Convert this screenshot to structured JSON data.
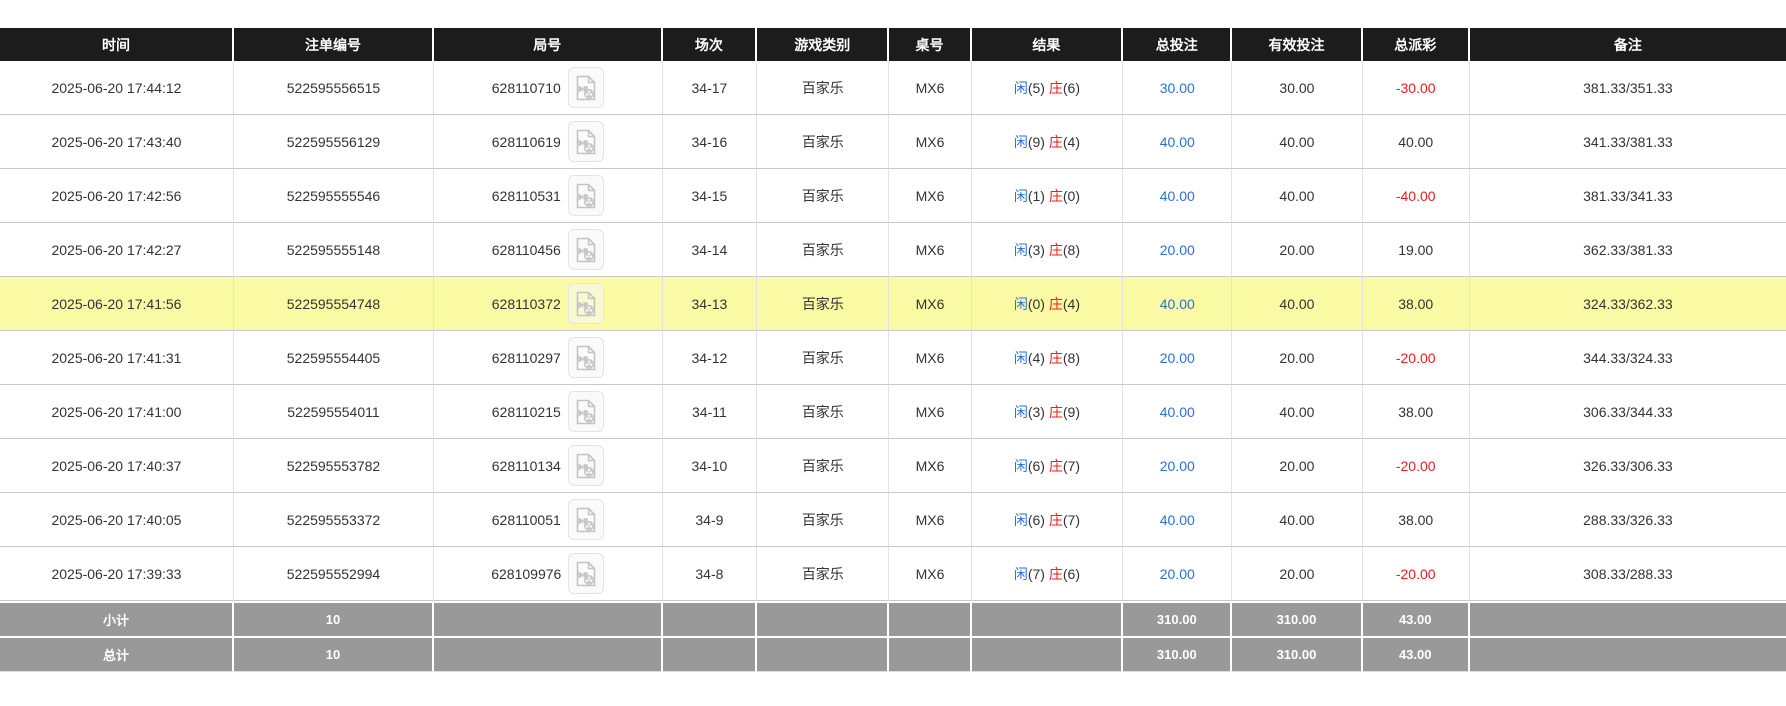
{
  "table": {
    "columns": [
      {
        "key": "time",
        "label": "时间"
      },
      {
        "key": "bet_id",
        "label": "注单编号"
      },
      {
        "key": "round",
        "label": "局号"
      },
      {
        "key": "session",
        "label": "场次"
      },
      {
        "key": "game",
        "label": "游戏类别"
      },
      {
        "key": "table_no",
        "label": "桌号"
      },
      {
        "key": "result",
        "label": "结果"
      },
      {
        "key": "total_bet",
        "label": "总投注"
      },
      {
        "key": "valid_bet",
        "label": "有效投注"
      },
      {
        "key": "payout",
        "label": "总派彩"
      },
      {
        "key": "remark",
        "label": "备注"
      }
    ],
    "result_labels": {
      "player": "闲",
      "banker": "庄"
    },
    "rows": [
      {
        "time": "2025-06-20 17:44:12",
        "bet_id": "522595556515",
        "round": "628110710",
        "session": "34-17",
        "game": "百家乐",
        "table_no": "MX6",
        "player": "5",
        "banker": "6",
        "total_bet": "30.00",
        "valid_bet": "30.00",
        "payout": "-30.00",
        "remark": "381.33/351.33",
        "highlighted": false
      },
      {
        "time": "2025-06-20 17:43:40",
        "bet_id": "522595556129",
        "round": "628110619",
        "session": "34-16",
        "game": "百家乐",
        "table_no": "MX6",
        "player": "9",
        "banker": "4",
        "total_bet": "40.00",
        "valid_bet": "40.00",
        "payout": "40.00",
        "remark": "341.33/381.33",
        "highlighted": false
      },
      {
        "time": "2025-06-20 17:42:56",
        "bet_id": "522595555546",
        "round": "628110531",
        "session": "34-15",
        "game": "百家乐",
        "table_no": "MX6",
        "player": "1",
        "banker": "0",
        "total_bet": "40.00",
        "valid_bet": "40.00",
        "payout": "-40.00",
        "remark": "381.33/341.33",
        "highlighted": false
      },
      {
        "time": "2025-06-20 17:42:27",
        "bet_id": "522595555148",
        "round": "628110456",
        "session": "34-14",
        "game": "百家乐",
        "table_no": "MX6",
        "player": "3",
        "banker": "8",
        "total_bet": "20.00",
        "valid_bet": "20.00",
        "payout": "19.00",
        "remark": "362.33/381.33",
        "highlighted": false
      },
      {
        "time": "2025-06-20 17:41:56",
        "bet_id": "522595554748",
        "round": "628110372",
        "session": "34-13",
        "game": "百家乐",
        "table_no": "MX6",
        "player": "0",
        "banker": "4",
        "total_bet": "40.00",
        "valid_bet": "40.00",
        "payout": "38.00",
        "remark": "324.33/362.33",
        "highlighted": true
      },
      {
        "time": "2025-06-20 17:41:31",
        "bet_id": "522595554405",
        "round": "628110297",
        "session": "34-12",
        "game": "百家乐",
        "table_no": "MX6",
        "player": "4",
        "banker": "8",
        "total_bet": "20.00",
        "valid_bet": "20.00",
        "payout": "-20.00",
        "remark": "344.33/324.33",
        "highlighted": false
      },
      {
        "time": "2025-06-20 17:41:00",
        "bet_id": "522595554011",
        "round": "628110215",
        "session": "34-11",
        "game": "百家乐",
        "table_no": "MX6",
        "player": "3",
        "banker": "9",
        "total_bet": "40.00",
        "valid_bet": "40.00",
        "payout": "38.00",
        "remark": "306.33/344.33",
        "highlighted": false
      },
      {
        "time": "2025-06-20 17:40:37",
        "bet_id": "522595553782",
        "round": "628110134",
        "session": "34-10",
        "game": "百家乐",
        "table_no": "MX6",
        "player": "6",
        "banker": "7",
        "total_bet": "20.00",
        "valid_bet": "20.00",
        "payout": "-20.00",
        "remark": "326.33/306.33",
        "highlighted": false
      },
      {
        "time": "2025-06-20 17:40:05",
        "bet_id": "522595553372",
        "round": "628110051",
        "session": "34-9",
        "game": "百家乐",
        "table_no": "MX6",
        "player": "6",
        "banker": "7",
        "total_bet": "40.00",
        "valid_bet": "40.00",
        "payout": "38.00",
        "remark": "288.33/326.33",
        "highlighted": false
      },
      {
        "time": "2025-06-20 17:39:33",
        "bet_id": "522595552994",
        "round": "628109976",
        "session": "34-8",
        "game": "百家乐",
        "table_no": "MX6",
        "player": "7",
        "banker": "6",
        "total_bet": "20.00",
        "valid_bet": "20.00",
        "payout": "-20.00",
        "remark": "308.33/288.33",
        "highlighted": false
      }
    ],
    "footer": [
      {
        "label": "小计",
        "count": "10",
        "total_bet": "310.00",
        "valid_bet": "310.00",
        "payout": "43.00"
      },
      {
        "label": "总计",
        "count": "10",
        "total_bet": "310.00",
        "valid_bet": "310.00",
        "payout": "43.00"
      }
    ],
    "icons": {
      "round_action": "video-replay-icon"
    }
  },
  "colors": {
    "header_bg": "#1c1c1c",
    "footer_bg": "#999999",
    "highlight_row": "#fafaa5",
    "player_blue": "#2a6fdb",
    "banker_red": "#ee1c1c",
    "negative_red": "#ee1c1c",
    "bet_amount_blue": "#2a6fdb"
  }
}
